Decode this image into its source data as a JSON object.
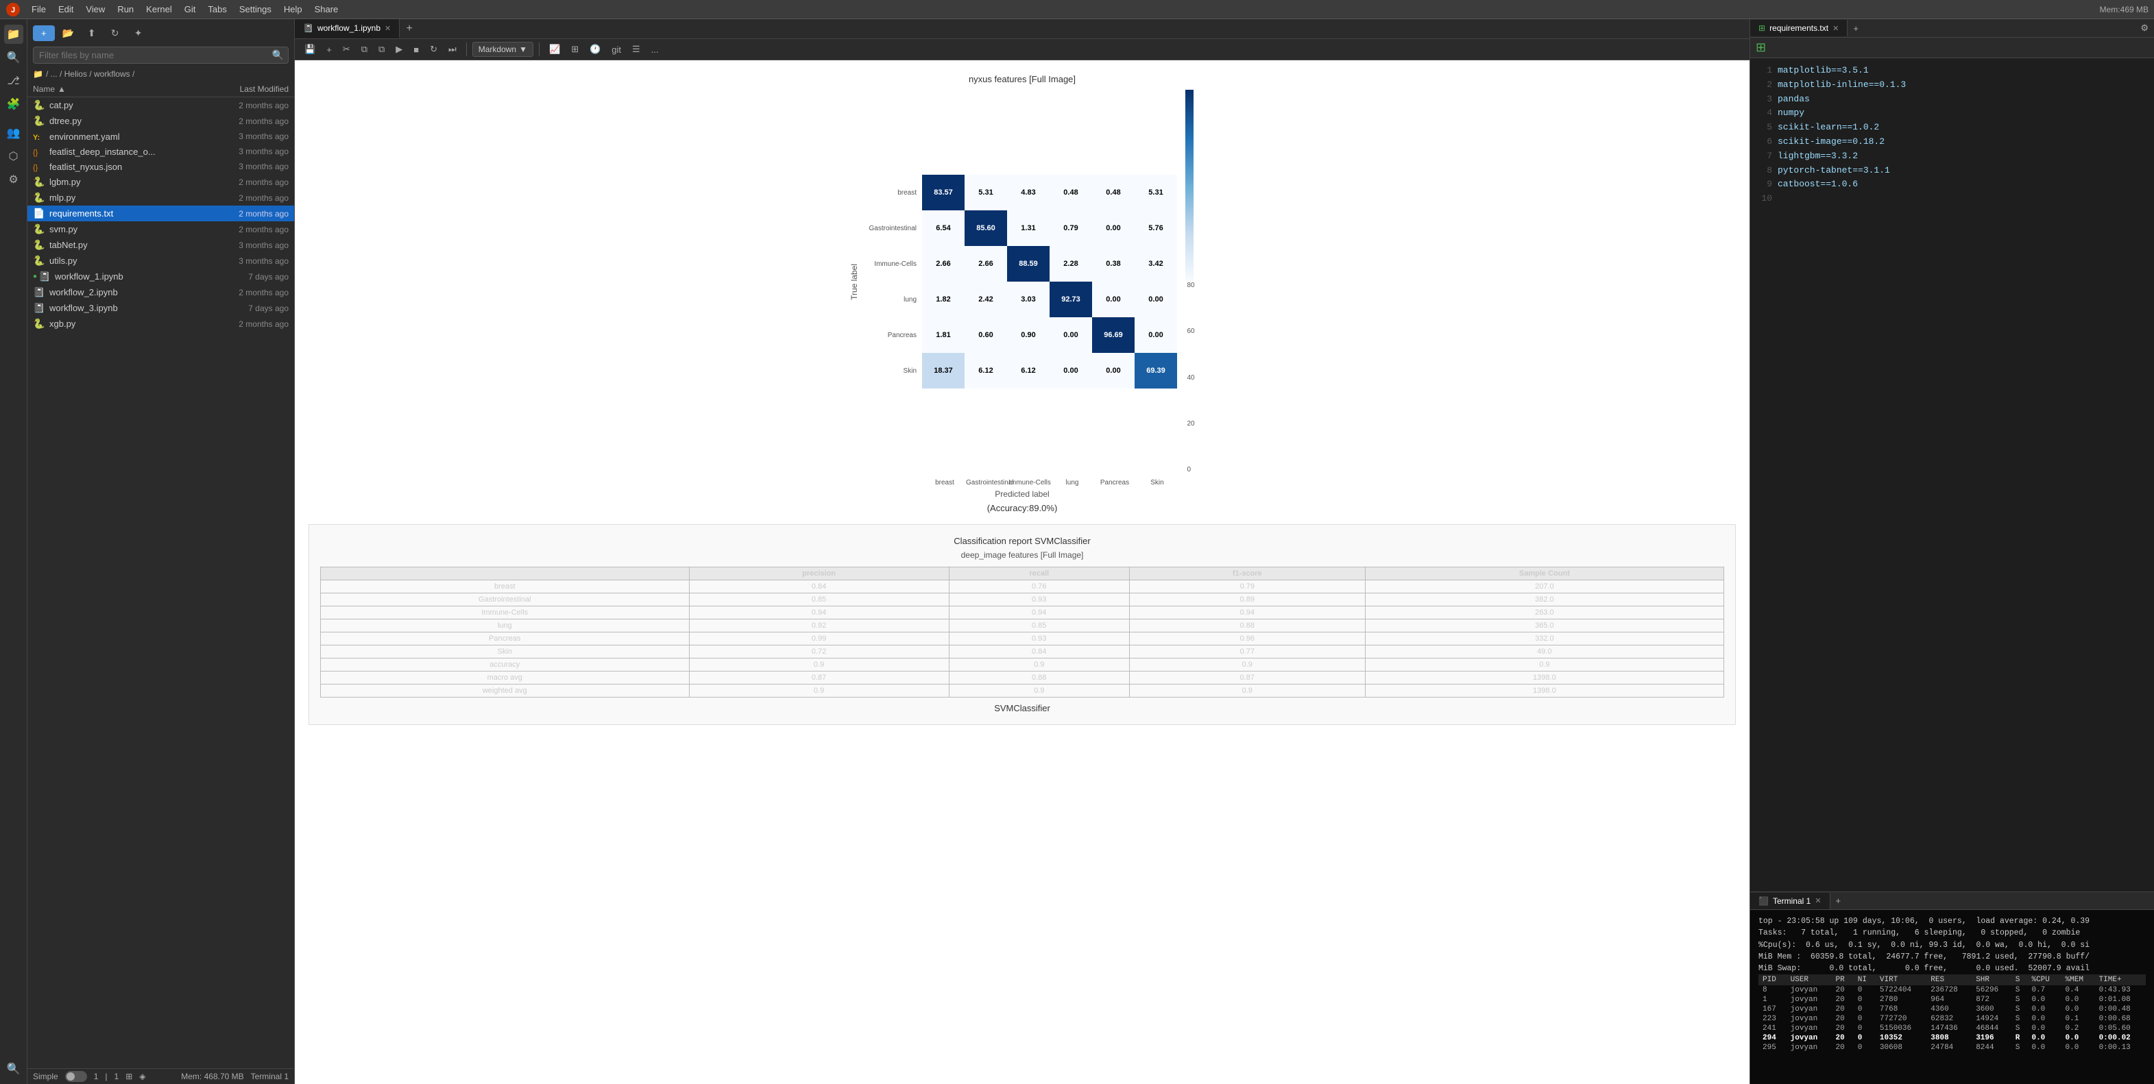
{
  "menubar": {
    "items": [
      "File",
      "Edit",
      "View",
      "Run",
      "Kernel",
      "Git",
      "Tabs",
      "Settings",
      "Help",
      "Share"
    ],
    "mem": "Mem:469 MB"
  },
  "sidebar": {
    "icons": [
      "folder",
      "search",
      "git",
      "puzzle",
      "users",
      "layers",
      "tools",
      "search2"
    ]
  },
  "file_panel": {
    "new_button": "+",
    "search_placeholder": "Filter files by name",
    "breadcrumb": "/ ... / Helios / workflows /",
    "headers": {
      "name": "Name",
      "sort_icon": "▲",
      "modified": "Last Modified"
    },
    "files": [
      {
        "name": "cat.py",
        "modified": "2 months ago",
        "icon": "🐍",
        "type": "py"
      },
      {
        "name": "dtree.py",
        "modified": "2 months ago",
        "icon": "🐍",
        "type": "py"
      },
      {
        "name": "environment.yaml",
        "modified": "3 months ago",
        "icon": "Y",
        "type": "yaml"
      },
      {
        "name": "featlist_deep_instance_o...",
        "modified": "3 months ago",
        "icon": "⚙",
        "type": "json"
      },
      {
        "name": "featlist_nyxus.json",
        "modified": "3 months ago",
        "icon": "⚙",
        "type": "json"
      },
      {
        "name": "lgbm.py",
        "modified": "2 months ago",
        "icon": "🐍",
        "type": "py"
      },
      {
        "name": "mlp.py",
        "modified": "2 months ago",
        "icon": "🐍",
        "type": "py"
      },
      {
        "name": "requirements.txt",
        "modified": "2 months ago",
        "icon": "📄",
        "type": "txt",
        "selected": true
      },
      {
        "name": "svm.py",
        "modified": "2 months ago",
        "icon": "🐍",
        "type": "py"
      },
      {
        "name": "tabNet.py",
        "modified": "3 months ago",
        "icon": "🐍",
        "type": "py"
      },
      {
        "name": "utils.py",
        "modified": "3 months ago",
        "icon": "🐍",
        "type": "py"
      },
      {
        "name": "workflow_1.ipynb",
        "modified": "7 days ago",
        "icon": "📓",
        "type": "ipynb",
        "dot": "green"
      },
      {
        "name": "workflow_2.ipynb",
        "modified": "2 months ago",
        "icon": "📓",
        "type": "ipynb"
      },
      {
        "name": "workflow_3.ipynb",
        "modified": "7 days ago",
        "icon": "📓",
        "type": "ipynb"
      },
      {
        "name": "xgb.py",
        "modified": "2 months ago",
        "icon": "🐍",
        "type": "py"
      }
    ]
  },
  "status_bar": {
    "mode": "Simple",
    "cursor": "1",
    "col": "1",
    "mem": "Mem: 468.70 MB",
    "terminal": "Terminal 1"
  },
  "notebook_tab": {
    "label": "workflow_1.ipynb",
    "toolbar": {
      "save": "💾",
      "add": "+",
      "cut": "✂",
      "copy": "⧉",
      "paste": "⧉",
      "run": "▶",
      "stop": "■",
      "restart": "↻",
      "forward": "⏭",
      "cell_type": "Markdown",
      "chart_icon": "📈",
      "table_icon": "⊞",
      "clock_icon": "🕐",
      "git_icon": "git",
      "markdown_icon": "☰",
      "more": "..."
    },
    "confusion_matrix": {
      "title": "nyxus features [Full Image]",
      "ylabel": "True label",
      "xlabel": "Predicted label",
      "accuracy": "(Accuracy:89.0%)",
      "row_labels": [
        "breast",
        "Gastrointestinal",
        "Immune-Cells",
        "lung",
        "Pancreas",
        "Skin"
      ],
      "col_labels": [
        "breast",
        "Gastrointestinal",
        "Immune-Cells",
        "lung",
        "Pancreas",
        "Skin"
      ],
      "data": [
        [
          83.57,
          5.31,
          4.83,
          0.48,
          0.48,
          5.31
        ],
        [
          6.54,
          85.6,
          1.31,
          0.79,
          0.0,
          5.76
        ],
        [
          2.66,
          2.66,
          88.59,
          2.28,
          0.38,
          3.42
        ],
        [
          1.82,
          2.42,
          3.03,
          92.73,
          0.0,
          0.0
        ],
        [
          1.81,
          0.6,
          0.9,
          0.0,
          96.69,
          0.0
        ],
        [
          18.37,
          6.12,
          6.12,
          0.0,
          0.0,
          69.39
        ]
      ],
      "colorbar_labels": [
        "80",
        "60",
        "40",
        "20",
        "0"
      ]
    },
    "classification_report": {
      "title": "Classification report SVMClassifier",
      "subtitle": "deep_image features [Full Image]",
      "headers": [
        "",
        "precision",
        "recall",
        "f1-score",
        "Sample Count"
      ],
      "rows": [
        [
          "breast",
          "0.84",
          "0.76",
          "0.79",
          "207.0"
        ],
        [
          "Gastrointestinal",
          "0.85",
          "0.93",
          "0.89",
          "382.0"
        ],
        [
          "Immune-Cells",
          "0.94",
          "0.94",
          "0.94",
          "263.0"
        ],
        [
          "lung",
          "0.92",
          "0.85",
          "0.88",
          "365.0"
        ],
        [
          "Pancreas",
          "0.99",
          "0.93",
          "0.96",
          "332.0"
        ],
        [
          "Skin",
          "0.72",
          "0.84",
          "0.77",
          "49.0"
        ],
        [
          "accuracy",
          "0.9",
          "0.9",
          "0.9",
          "0.9"
        ],
        [
          "macro avg",
          "0.87",
          "0.88",
          "0.87",
          "1398.0"
        ],
        [
          "weighted avg",
          "0.9",
          "0.9",
          "0.9",
          "1398.0"
        ]
      ],
      "footer": "SVMClassifier"
    }
  },
  "requirements_tab": {
    "label": "requirements.txt",
    "lines": [
      {
        "num": "1",
        "text": "matplotlib==3.5.1"
      },
      {
        "num": "2",
        "text": "matplotlib-inline==0.1.3"
      },
      {
        "num": "3",
        "text": "pandas"
      },
      {
        "num": "4",
        "text": "numpy"
      },
      {
        "num": "5",
        "text": "scikit-learn==1.0.2"
      },
      {
        "num": "6",
        "text": "scikit-image==0.18.2"
      },
      {
        "num": "7",
        "text": "lightgbm==3.3.2"
      },
      {
        "num": "8",
        "text": "pytorch-tabnet==3.1.1"
      },
      {
        "num": "9",
        "text": "catboost==1.0.6"
      },
      {
        "num": "10",
        "text": ""
      }
    ]
  },
  "terminal": {
    "label": "Terminal 1",
    "lines": [
      "top - 23:05:58 up 109 days, 10:06,  0 users,  load average: 0.24, 0.39",
      "Tasks:   7 total,   1 running,   6 sleeping,   0 stopped,   0 zombie",
      "%Cpu(s):  0.6 us,  0.1 sy,  0.0 ni, 99.3 id,  0.0 wa,  0.0 hi,  0.0 si",
      "MiB Mem :  60359.8 total,  24677.7 free,   7891.2 used,  27790.8 buff/",
      "MiB Swap:      0.0 total,      0.0 free,      0.0 used.  52007.9 avail"
    ],
    "proc_headers": [
      "PID",
      "USER",
      "PR",
      "NI",
      "VIRT",
      "RES",
      "SHR",
      "S",
      "%CPU",
      "%MEM",
      "TIME+"
    ],
    "procs": [
      {
        "pid": "8",
        "user": "jovyan",
        "pr": "20",
        "ni": "0",
        "virt": "5722404",
        "res": "236728",
        "shr": "56296",
        "s": "S",
        "cpu": "0.7",
        "mem": "0.4",
        "time": "0:43.93",
        "bold": false
      },
      {
        "pid": "1",
        "user": "jovyan",
        "pr": "20",
        "ni": "0",
        "virt": "2780",
        "res": "964",
        "shr": "872",
        "s": "S",
        "cpu": "0.0",
        "mem": "0.0",
        "time": "0:01.08",
        "bold": false
      },
      {
        "pid": "167",
        "user": "jovyan",
        "pr": "20",
        "ni": "0",
        "virt": "7768",
        "res": "4360",
        "shr": "3600",
        "s": "S",
        "cpu": "0.0",
        "mem": "0.0",
        "time": "0:00.48",
        "bold": false
      },
      {
        "pid": "223",
        "user": "jovyan",
        "pr": "20",
        "ni": "0",
        "virt": "772720",
        "res": "62832",
        "shr": "14924",
        "s": "S",
        "cpu": "0.0",
        "mem": "0.1",
        "time": "0:00.68",
        "bold": false
      },
      {
        "pid": "241",
        "user": "jovyan",
        "pr": "20",
        "ni": "0",
        "virt": "5150036",
        "res": "147436",
        "shr": "46844",
        "s": "S",
        "cpu": "0.0",
        "mem": "0.2",
        "time": "0:05.60",
        "bold": false
      },
      {
        "pid": "294",
        "user": "jovyan",
        "pr": "20",
        "ni": "0",
        "virt": "10352",
        "res": "3808",
        "shr": "3196",
        "s": "R",
        "cpu": "0.0",
        "mem": "0.0",
        "time": "0:00.02",
        "bold": true
      },
      {
        "pid": "295",
        "user": "jovyan",
        "pr": "20",
        "ni": "0",
        "virt": "30608",
        "res": "24784",
        "shr": "8244",
        "s": "S",
        "cpu": "0.0",
        "mem": "0.0",
        "time": "0:00.13",
        "bold": false
      }
    ]
  },
  "colors": {
    "cm_high": "#08306b",
    "cm_mid": "#2171b5",
    "cm_low": "#c6dbef",
    "cm_lowest": "#f7fbff",
    "selected_file": "#1565c0",
    "accent": "#4a90d9"
  }
}
